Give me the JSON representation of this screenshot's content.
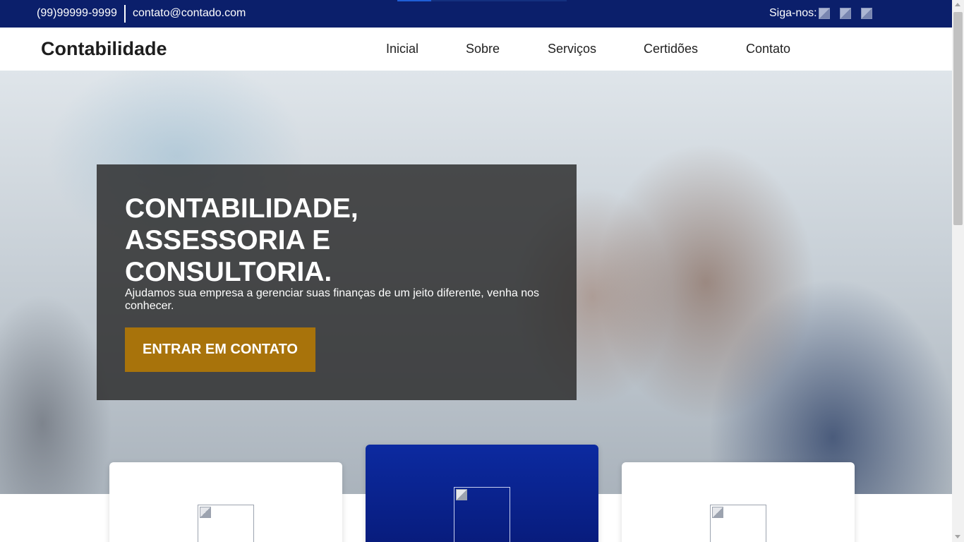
{
  "topbar": {
    "phone": "(99)99999-9999",
    "email": "contato@contado.com",
    "follow_label": "Siga-nos:",
    "social_icons": [
      "broken-image-icon",
      "broken-image-icon",
      "broken-image-icon"
    ]
  },
  "header": {
    "brand": "Contabilidade",
    "nav": [
      {
        "label": "Inicial"
      },
      {
        "label": "Sobre"
      },
      {
        "label": "Serviços"
      },
      {
        "label": "Certidões"
      },
      {
        "label": "Contato"
      }
    ]
  },
  "hero": {
    "headline": "CONTABILIDADE, ASSESSORIA E CONSULTORIA.",
    "subtext": "Ajudamos sua empresa a gerenciar suas finanças de um jeito diferente, venha nos conhecer.",
    "cta_label": "ENTRAR EM CONTATO"
  },
  "colors": {
    "topbar": "#0b1f6b",
    "accent": "#a8730b",
    "card_highlight": "#0c2aa0"
  }
}
